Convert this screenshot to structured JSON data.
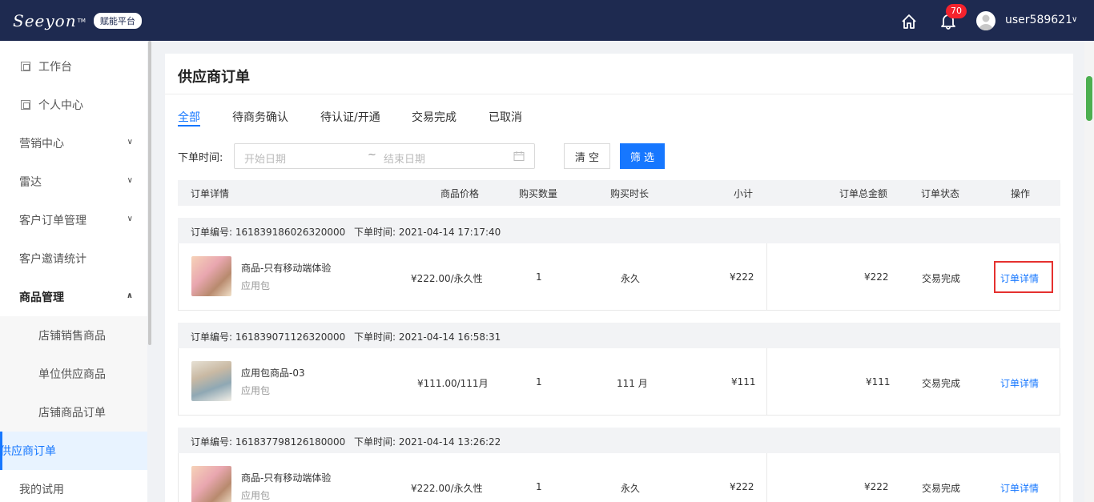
{
  "header": {
    "logo": "Seeyon",
    "logo_badge": "赋能平台",
    "notification_count": "70",
    "username": "user589621"
  },
  "sidebar": {
    "items": [
      {
        "label": "工作台"
      },
      {
        "label": "个人中心"
      },
      {
        "label": "营销中心"
      },
      {
        "label": "雷达"
      },
      {
        "label": "客户订单管理"
      },
      {
        "label": "客户邀请统计"
      },
      {
        "label": "商品管理"
      },
      {
        "label": "店铺销售商品"
      },
      {
        "label": "单位供应商品"
      },
      {
        "label": "店铺商品订单"
      },
      {
        "label": "供应商订单"
      },
      {
        "label": "我的试用"
      }
    ]
  },
  "main": {
    "title": "供应商订单",
    "tabs": [
      {
        "label": "全部"
      },
      {
        "label": "待商务确认"
      },
      {
        "label": "待认证/开通"
      },
      {
        "label": "交易完成"
      },
      {
        "label": "已取消"
      }
    ],
    "filter": {
      "label": "下单时间:",
      "start_placeholder": "开始日期",
      "separator": "~",
      "end_placeholder": "结束日期",
      "clear_label": "清 空",
      "filter_label": "筛 选"
    },
    "columns": [
      "订单详情",
      "商品价格",
      "购买数量",
      "购买时长",
      "小计",
      "订单总金额",
      "订单状态",
      "操作"
    ],
    "orders": [
      {
        "order_no": "订单编号: 161839186026320000",
        "order_time": "下单时间: 2021-04-14 17:17:40",
        "product_name": "商品-只有移动端体验",
        "product_type": "应用包",
        "price": "¥222.00/永久性",
        "quantity": "1",
        "duration": "永久",
        "subtotal": "¥222",
        "total": "¥222",
        "status": "交易完成",
        "action": "订单详情"
      },
      {
        "order_no": "订单编号: 161839071126320000",
        "order_time": "下单时间: 2021-04-14 16:58:31",
        "product_name": "应用包商品-03",
        "product_type": "应用包",
        "price": "¥111.00/111月",
        "quantity": "1",
        "duration": "111 月",
        "subtotal": "¥111",
        "total": "¥111",
        "status": "交易完成",
        "action": "订单详情"
      },
      {
        "order_no": "订单编号: 161837798126180000",
        "order_time": "下单时间: 2021-04-14 13:26:22",
        "product_name": "商品-只有移动端体验",
        "product_type": "应用包",
        "price": "¥222.00/永久性",
        "quantity": "1",
        "duration": "永久",
        "subtotal": "¥222",
        "total": "¥222",
        "status": "交易完成",
        "action": "订单详情"
      }
    ]
  },
  "colors": {
    "header_bg": "#1e2a50",
    "accent": "#1677ff",
    "highlight": "#e5312f"
  }
}
